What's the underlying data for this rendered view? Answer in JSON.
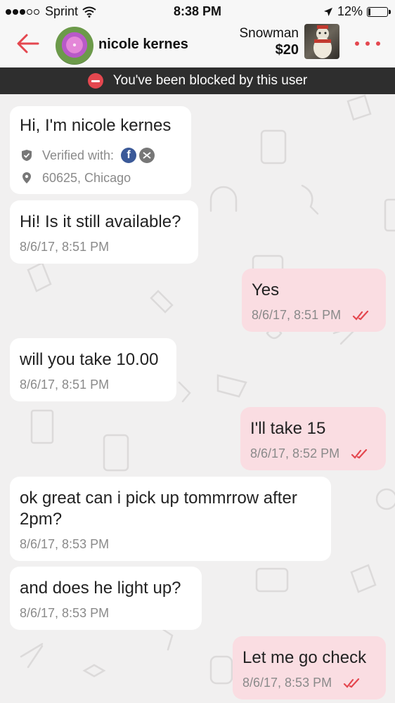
{
  "status_bar": {
    "carrier": "Sprint",
    "time": "8:38 PM",
    "battery_percent": "12%",
    "battery_level": 0.12
  },
  "header": {
    "user_name": "nicole kernes",
    "listing_title": "Snowman",
    "listing_price": "$20"
  },
  "banner": {
    "text": "You've been blocked by this user"
  },
  "intro": {
    "greeting": "Hi, I'm nicole kernes",
    "verified_label": "Verified with:",
    "location": "60625, Chicago"
  },
  "messages": [
    {
      "text": "Hi! Is it still available?",
      "time": "8/6/17, 8:51 PM",
      "direction": "in"
    },
    {
      "text": "Yes",
      "time": "8/6/17, 8:51 PM",
      "direction": "out"
    },
    {
      "text": "will you take 10.00",
      "time": "8/6/17, 8:51 PM",
      "direction": "in"
    },
    {
      "text": "I'll take 15",
      "time": "8/6/17, 8:52 PM",
      "direction": "out"
    },
    {
      "text": "ok great can i pick up tommrrow after 2pm?",
      "time": "8/6/17, 8:53 PM",
      "direction": "in"
    },
    {
      "text": "and does he light up?",
      "time": "8/6/17, 8:53 PM",
      "direction": "in"
    },
    {
      "text": "Let me go check",
      "time": "8/6/17, 8:53 PM",
      "direction": "out"
    }
  ],
  "colors": {
    "accent": "#e4474f",
    "banner_bg": "#2e2e2e",
    "incoming_bubble": "#ffffff",
    "outgoing_bubble": "#fadde2",
    "background": "#f1f0f0"
  }
}
